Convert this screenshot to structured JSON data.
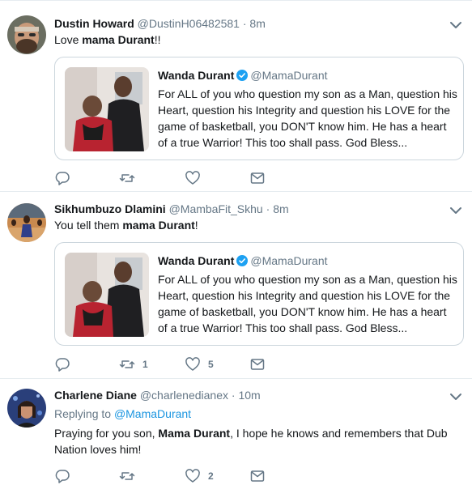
{
  "tweets": [
    {
      "name": "Dustin Howard",
      "handle": "@DustinH06482581",
      "time": "8m",
      "text_pre": "Love ",
      "text_bold": "mama Durant",
      "text_post": "!!",
      "quote": {
        "name": "Wanda Durant",
        "handle": "@MamaDurant",
        "text": "For ALL of you who question my son as a Man, question his Heart, question his Integrity and question his LOVE for the game of basketball, you DON'T know him.  He has a heart of a true Warrior! This too shall pass. God Bless..."
      },
      "retweets": "",
      "likes": ""
    },
    {
      "name": "Sikhumbuzo Dlamini",
      "handle": "@MambaFit_Skhu",
      "time": "8m",
      "text_pre": "You tell them ",
      "text_bold": "mama Durant",
      "text_post": "!",
      "quote": {
        "name": "Wanda Durant",
        "handle": "@MamaDurant",
        "text": "For ALL of you who question my son as a Man, question his Heart, question his Integrity and question his LOVE for the game of basketball, you DON'T know him.  He has a heart of a true Warrior! This too shall pass. God Bless..."
      },
      "retweets": "1",
      "likes": "5"
    },
    {
      "name": "Charlene Diane",
      "handle": "@charlenedianex",
      "time": "10m",
      "replying_label": "Replying to",
      "replying_to": "@MamaDurant",
      "text_pre": "Praying for you son, ",
      "text_bold": "Mama Durant",
      "text_post": ", I hope he knows and remembers that Dub Nation loves him!",
      "retweets": "",
      "likes": "2"
    }
  ],
  "separator": "·",
  "colors": {
    "accent": "#1b95e0",
    "secondary_text": "#657786",
    "border": "#e6ecf0"
  }
}
